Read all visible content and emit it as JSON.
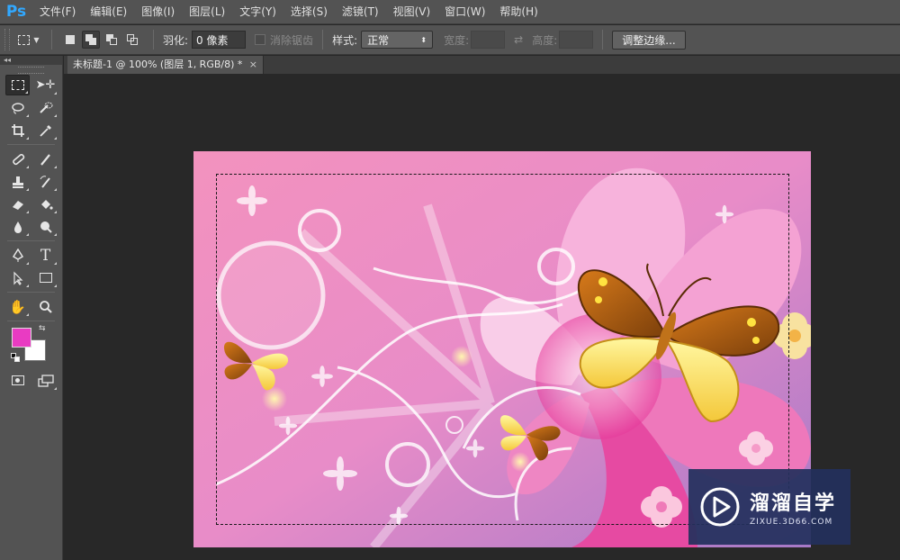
{
  "app": {
    "logo": "Ps"
  },
  "menu": [
    "文件(F)",
    "编辑(E)",
    "图像(I)",
    "图层(L)",
    "文字(Y)",
    "选择(S)",
    "滤镜(T)",
    "视图(V)",
    "窗口(W)",
    "帮助(H)"
  ],
  "options": {
    "feather_label": "羽化:",
    "feather_value": "0 像素",
    "antialias_label": "消除锯齿",
    "style_label": "样式:",
    "style_value": "正常",
    "width_label": "宽度:",
    "height_label": "高度:",
    "refine_edge": "调整边缘..."
  },
  "toolpanel": {
    "collapse": "◂◂"
  },
  "document": {
    "tab_title": "未标题-1 @ 100% (图层 1, RGB/8) *",
    "close": "×"
  },
  "colors": {
    "foreground": "#e93bc2",
    "background": "#ffffff",
    "accent": "#31a8ff"
  },
  "watermark": {
    "title": "溜溜自学",
    "url": "ZIXUE.3D66.COM"
  }
}
